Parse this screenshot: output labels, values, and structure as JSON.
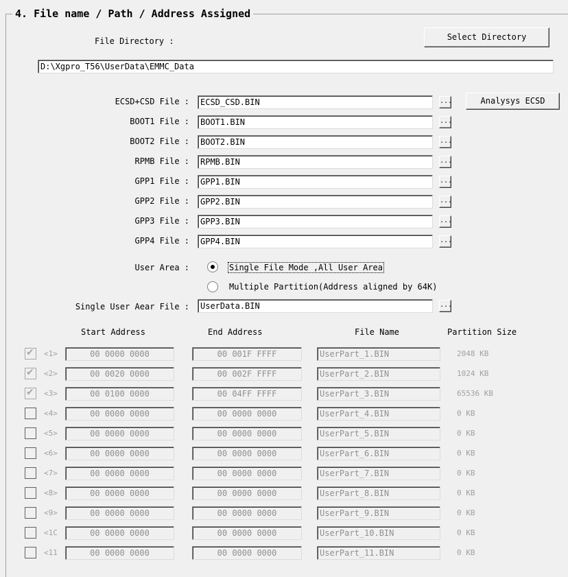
{
  "group": {
    "title": "4. File name / Path / Address Assigned"
  },
  "directory": {
    "label": "File Directory :",
    "select_button": "Select Directory",
    "path": "D:\\Xgpro_T56\\UserData\\EMMC_Data"
  },
  "files": [
    {
      "label": "ECSD+CSD File :",
      "value": "ECSD_CSD.BIN"
    },
    {
      "label": "BOOT1 File :",
      "value": "BOOT1.BIN"
    },
    {
      "label": "BOOT2 File :",
      "value": "BOOT2.BIN"
    },
    {
      "label": "RPMB File :",
      "value": "RPMB.BIN"
    },
    {
      "label": "GPP1 File :",
      "value": "GPP1.BIN"
    },
    {
      "label": "GPP2 File :",
      "value": "GPP2.BIN"
    },
    {
      "label": "GPP3 File :",
      "value": "GPP3.BIN"
    },
    {
      "label": "GPP4 File :",
      "value": "GPP4.BIN"
    }
  ],
  "browse_label": "...",
  "analysys_button": "Analysys ECSD",
  "user_area": {
    "label": "User Area :",
    "options": [
      {
        "label": "Single File Mode ,All User Area",
        "selected": true
      },
      {
        "label": "Multiple Partition(Address aligned by 64K)",
        "selected": false
      }
    ],
    "single_file_label": "Single User Aear File :",
    "single_file_value": "UserData.BIN"
  },
  "table": {
    "headers": [
      "Start Address",
      "End Address",
      "File Name",
      "Partition Size"
    ],
    "rows": [
      {
        "checked": true,
        "index": "<1>",
        "start": "00 0000 0000",
        "end": "00 001F FFFF",
        "file": "UserPart_1.BIN",
        "size": "2048 KB"
      },
      {
        "checked": true,
        "index": "<2>",
        "start": "00 0020 0000",
        "end": "00 002F FFFF",
        "file": "UserPart_2.BIN",
        "size": "1024 KB"
      },
      {
        "checked": true,
        "index": "<3>",
        "start": "00 0100 0000",
        "end": "00 04FF FFFF",
        "file": "UserPart_3.BIN",
        "size": "65536 KB"
      },
      {
        "checked": false,
        "index": "<4>",
        "start": "00 0000 0000",
        "end": "00 0000 0000",
        "file": "UserPart_4.BIN",
        "size": "0 KB"
      },
      {
        "checked": false,
        "index": "<5>",
        "start": "00 0000 0000",
        "end": "00 0000 0000",
        "file": "UserPart_5.BIN",
        "size": "0 KB"
      },
      {
        "checked": false,
        "index": "<6>",
        "start": "00 0000 0000",
        "end": "00 0000 0000",
        "file": "UserPart_6.BIN",
        "size": "0 KB"
      },
      {
        "checked": false,
        "index": "<7>",
        "start": "00 0000 0000",
        "end": "00 0000 0000",
        "file": "UserPart_7.BIN",
        "size": "0 KB"
      },
      {
        "checked": false,
        "index": "<8>",
        "start": "00 0000 0000",
        "end": "00 0000 0000",
        "file": "UserPart_8.BIN",
        "size": "0 KB"
      },
      {
        "checked": false,
        "index": "<9>",
        "start": "00 0000 0000",
        "end": "00 0000 0000",
        "file": "UserPart_9.BIN",
        "size": "0 KB"
      },
      {
        "checked": false,
        "index": "<1C",
        "start": "00 0000 0000",
        "end": "00 0000 0000",
        "file": "UserPart_10.BIN",
        "size": "0 KB"
      },
      {
        "checked": false,
        "index": "<11",
        "start": "00 0000 0000",
        "end": "00 0000 0000",
        "file": "UserPart_11.BIN",
        "size": "0 KB"
      }
    ]
  }
}
